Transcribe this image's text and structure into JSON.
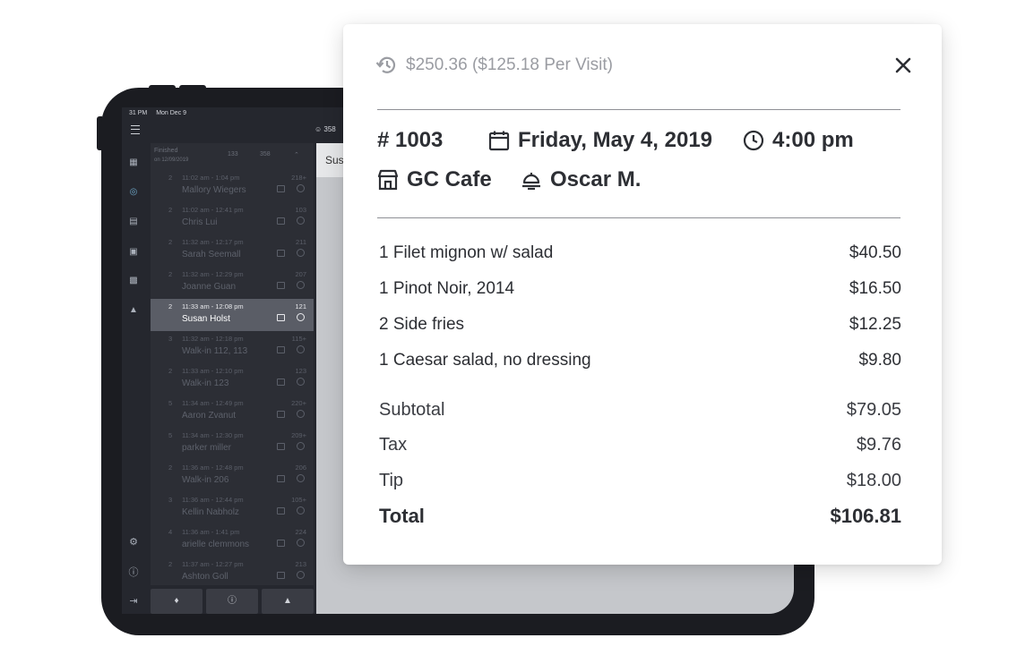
{
  "tablet": {
    "status_time": "31 PM",
    "status_date": "Mon Dec 9",
    "top_count": "358",
    "list_header": {
      "title": "Finished",
      "subtitle": "on 12/09/2019",
      "count_a": "133",
      "count_b": "358"
    },
    "rows": [
      {
        "num": "2",
        "time": "11:02 am - 1:04 pm",
        "name": "Mallory Wiegers",
        "count": "218+"
      },
      {
        "num": "2",
        "time": "11:02 am - 12:41 pm",
        "name": "Chris Lui",
        "count": "103"
      },
      {
        "num": "2",
        "time": "11:32 am - 12:17 pm",
        "name": "Sarah Seemall",
        "count": "211"
      },
      {
        "num": "2",
        "time": "11:32 am - 12:29 pm",
        "name": "Joanne Guan",
        "count": "207"
      },
      {
        "num": "2",
        "time": "11:33 am - 12:08 pm",
        "name": "Susan Holst",
        "count": "121"
      },
      {
        "num": "3",
        "time": "11:32 am - 12:18 pm",
        "name": "Walk-in 112, 113",
        "count": "115+"
      },
      {
        "num": "2",
        "time": "11:33 am - 12:10 pm",
        "name": "Walk-in 123",
        "count": "123"
      },
      {
        "num": "5",
        "time": "11:34 am - 12:49 pm",
        "name": "Aaron Zvanut",
        "count": "220+"
      },
      {
        "num": "5",
        "time": "11:34 am - 12:30 pm",
        "name": "parker miller",
        "count": "209+"
      },
      {
        "num": "2",
        "time": "11:36 am - 12:48 pm",
        "name": "Walk-in 206",
        "count": "206"
      },
      {
        "num": "3",
        "time": "11:36 am - 12:44 pm",
        "name": "Kellin Nabholz",
        "count": "105+"
      },
      {
        "num": "4",
        "time": "11:36 am - 1:41 pm",
        "name": "arielle clemmons",
        "count": "224"
      },
      {
        "num": "2",
        "time": "11:37 am - 12:27 pm",
        "name": "Ashton Goll",
        "count": "213"
      }
    ],
    "detail_title": "Sus"
  },
  "receipt": {
    "history": "$250.36 ($125.18 Per Visit)",
    "order_number": "# 1003",
    "date": "Friday, May 4, 2019",
    "time": "4:00 pm",
    "venue": "GC Cafe",
    "server": "Oscar M.",
    "items": [
      {
        "label": "1 Filet mignon w/ salad",
        "price": "$40.50"
      },
      {
        "label": "1 Pinot Noir, 2014",
        "price": "$16.50"
      },
      {
        "label": "2 Side fries",
        "price": "$12.25"
      },
      {
        "label": "1 Caesar salad, no dressing",
        "price": "$9.80"
      }
    ],
    "subtotal_label": "Subtotal",
    "subtotal": "$79.05",
    "tax_label": "Tax",
    "tax": "$9.76",
    "tip_label": "Tip",
    "tip": "$18.00",
    "total_label": "Total",
    "total": "$106.81"
  }
}
